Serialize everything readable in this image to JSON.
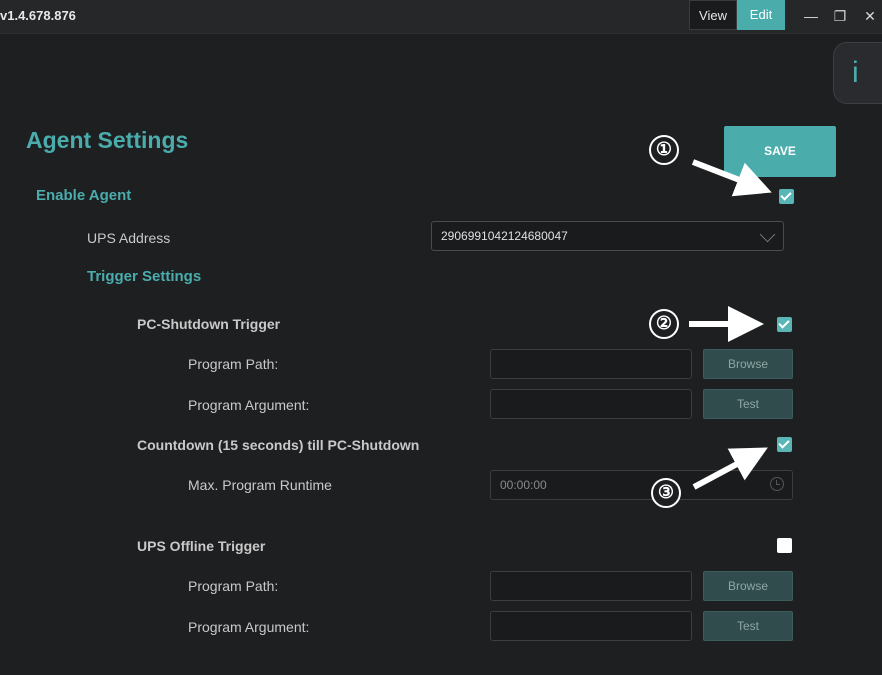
{
  "titlebar": {
    "version": "v1.4.678.876",
    "view_label": "View",
    "edit_label": "Edit"
  },
  "info_tab": {
    "glyph": "i"
  },
  "page_title": "Agent Settings",
  "save_label": "SAVE",
  "enable_agent": {
    "label": "Enable Agent",
    "checked": true
  },
  "ups_address": {
    "label": "UPS Address",
    "value": "290699104212468004​7"
  },
  "trigger_settings_label": "Trigger Settings",
  "pc_shutdown": {
    "label": "PC-Shutdown Trigger",
    "checked": true,
    "program_path_label": "Program Path:",
    "program_argument_label": "Program Argument:",
    "browse_label": "Browse",
    "test_label": "Test"
  },
  "countdown": {
    "label": "Countdown (15 seconds) till PC-Shutdown",
    "checked": true,
    "max_runtime_label": "Max. Program Runtime",
    "max_runtime_value": "00:00:00"
  },
  "ups_offline": {
    "label": "UPS Offline Trigger",
    "checked": false,
    "program_path_label": "Program Path:",
    "program_argument_label": "Program Argument:",
    "browse_label": "Browse",
    "test_label": "Test"
  },
  "markers": [
    "①",
    "②",
    "③"
  ],
  "colors": {
    "accent": "#4bacac",
    "background": "#1e1f21"
  }
}
